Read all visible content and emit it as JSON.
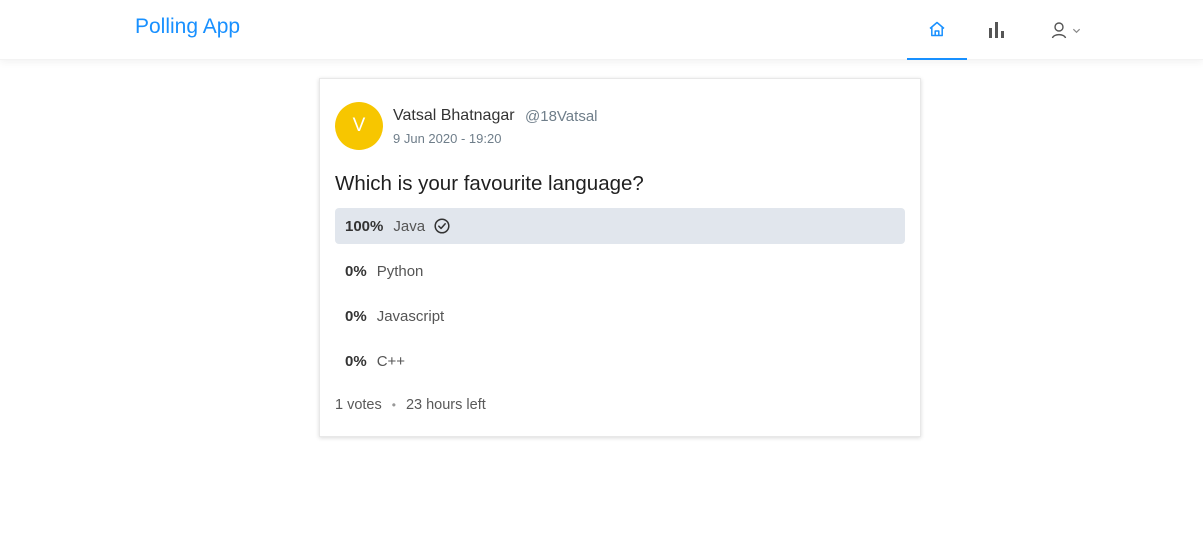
{
  "header": {
    "app_title": "Polling App",
    "nav": [
      {
        "icon": "home-icon",
        "active": true
      },
      {
        "icon": "bar-chart-icon",
        "active": false
      },
      {
        "icon": "user-icon",
        "dropdown_icon": "chevron-down-icon",
        "active": false
      }
    ]
  },
  "poll": {
    "avatar_letter": "V",
    "avatar_color": "#f7c600",
    "creator_name": "Vatsal Bhatnagar",
    "creator_username": "@18Vatsal",
    "created_at": "9 Jun 2020 - 19:20",
    "question": "Which is your favourite language?",
    "choices": [
      {
        "percent": "100%",
        "text": "Java",
        "selected": true,
        "selected_icon": "check-circle-icon"
      },
      {
        "percent": "0%",
        "text": "Python",
        "selected": false
      },
      {
        "percent": "0%",
        "text": "Javascript",
        "selected": false
      },
      {
        "percent": "0%",
        "text": "C++",
        "selected": false
      }
    ],
    "votes": "1 votes",
    "separator": "•",
    "time_left": "23 hours left"
  },
  "colors": {
    "accent": "#1890ff",
    "winner_bg": "#e1e6ed"
  }
}
